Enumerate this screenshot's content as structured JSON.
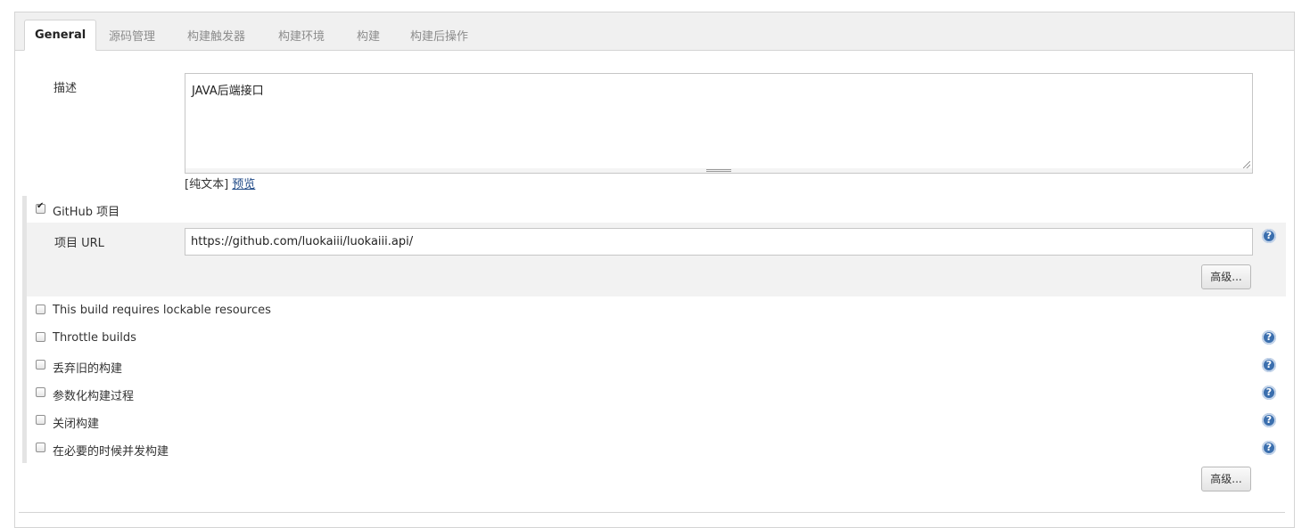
{
  "tabs": [
    "General",
    "源码管理",
    "构建触发器",
    "构建环境",
    "构建",
    "构建后操作"
  ],
  "description": {
    "label": "描述",
    "value": "JAVA后端接口",
    "format_plain": "[纯文本]",
    "format_preview": "预览"
  },
  "github": {
    "checkbox_label": "GitHub 项目",
    "checked": true,
    "url_label": "项目 URL",
    "url_value": "https://github.com/luokaiii/luokaiii.api/",
    "advanced_button": "高级..."
  },
  "options": [
    {
      "label": "This build requires lockable resources",
      "checked": false,
      "help": false
    },
    {
      "label": "Throttle builds",
      "checked": false,
      "help": true
    },
    {
      "label": "丢弃旧的构建",
      "checked": false,
      "help": true
    },
    {
      "label": "参数化构建过程",
      "checked": false,
      "help": true
    },
    {
      "label": "关闭构建",
      "checked": false,
      "help": true
    },
    {
      "label": "在必要的时候并发构建",
      "checked": false,
      "help": true
    }
  ],
  "advanced_button": "高级...",
  "help_glyph": "?",
  "colors": {
    "help_icon": "#3b6fae",
    "link": "#204a87",
    "tab_bar": "#f0f0f0",
    "section_bg": "#f2f2f2"
  }
}
